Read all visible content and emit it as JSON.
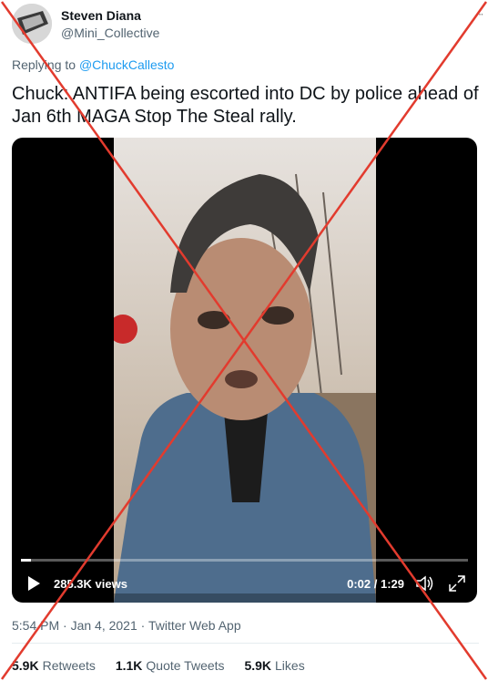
{
  "author": {
    "display_name": "Steven Diana",
    "handle": "@Mini_Collective"
  },
  "reply": {
    "prefix": "Replying to",
    "to_handle": "@ChuckCallesto"
  },
  "tweet": {
    "text": "Chuck: ANTIFA being escorted into DC by police ahead of Jan 6th MAGA Stop The Steal rally."
  },
  "video": {
    "views": "285.3K views",
    "time": "0:02 / 1:29",
    "progress_fraction": 0.022
  },
  "meta": {
    "timestamp": "5:54 PM · Jan 4, 2021 · Twitter Web App"
  },
  "stats": {
    "retweets_count": "5.9K",
    "retweets_label": "Retweets",
    "quote_count": "1.1K",
    "quote_label": "Quote Tweets",
    "likes_count": "5.9K",
    "likes_label": "Likes"
  },
  "icons": {
    "more": "more-icon",
    "play": "play-icon",
    "volume": "volume-icon",
    "fullscreen": "fullscreen-icon"
  },
  "colors": {
    "link": "#1d9bf0",
    "overlay_x": "#e23b2e"
  }
}
